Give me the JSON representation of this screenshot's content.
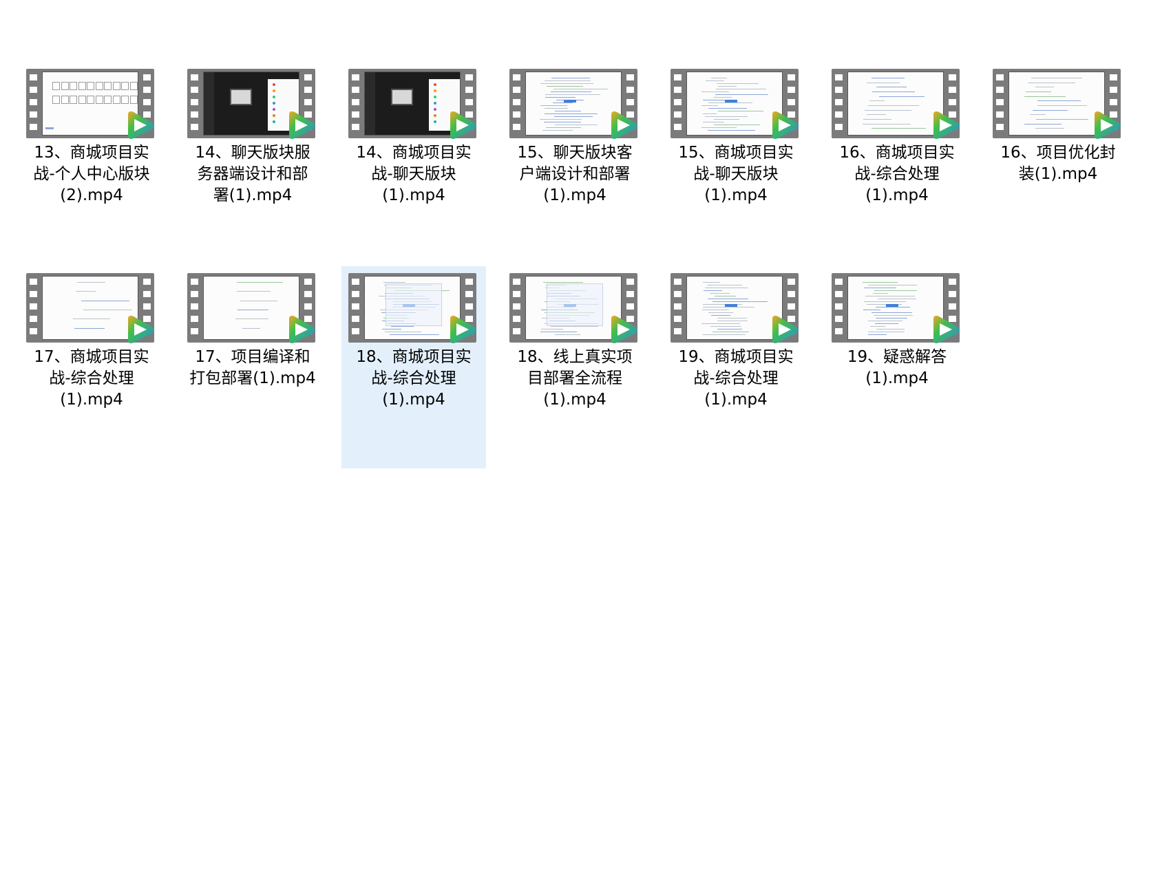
{
  "window": {
    "view": "large-icons",
    "selected_index": 9
  },
  "files": [
    {
      "line1": "13、商城项目实",
      "line2": "战-个人中心版块",
      "line3": "(2).mp4",
      "thumb": "grid"
    },
    {
      "line1": "14、聊天版块服",
      "line2": "务器端设计和部",
      "line3": "署(1).mp4",
      "thumb": "dark"
    },
    {
      "line1": "14、商城项目实",
      "line2": "战-聊天版块",
      "line3": "(1).mp4",
      "thumb": "dark"
    },
    {
      "line1": "15、聊天版块客",
      "line2": "户端设计和部署",
      "line3": "(1).mp4",
      "thumb": "code"
    },
    {
      "line1": "15、商城项目实",
      "line2": "战-聊天版块",
      "line3": "(1).mp4",
      "thumb": "code"
    },
    {
      "line1": "16、商城项目实",
      "line2": "战-综合处理",
      "line3": "(1).mp4",
      "thumb": "sparse"
    },
    {
      "line1": "16、项目优化封",
      "line2": "装(1).mp4",
      "line3": "",
      "thumb": "sparse"
    },
    {
      "line1": "17、商城项目实",
      "line2": "战-综合处理",
      "line3": "(1).mp4",
      "thumb": "blank"
    },
    {
      "line1": "17、项目编译和",
      "line2": "打包部署(1).mp4",
      "line3": "",
      "thumb": "blank"
    },
    {
      "line1": "18、商城项目实",
      "line2": "战-综合处理",
      "line3": "(1).mp4",
      "thumb": "dialog"
    },
    {
      "line1": "18、线上真实项",
      "line2": "目部署全流程",
      "line3": "(1).mp4",
      "thumb": "dialog"
    },
    {
      "line1": "19、商城项目实",
      "line2": "战-综合处理",
      "line3": "(1).mp4",
      "thumb": "code"
    },
    {
      "line1": "19、疑惑解答",
      "line2": "(1).mp4",
      "line3": "",
      "thumb": "code"
    }
  ],
  "icons": {
    "file_icon": "video-file-icon",
    "badge": "play-badge-icon"
  },
  "colors": {
    "selection": "#e3f0fc",
    "filmstrip": "#7b7b7b",
    "badge_green": "#3fbf4a",
    "badge_blue": "#2a8de0",
    "badge_orange": "#f5a623"
  }
}
